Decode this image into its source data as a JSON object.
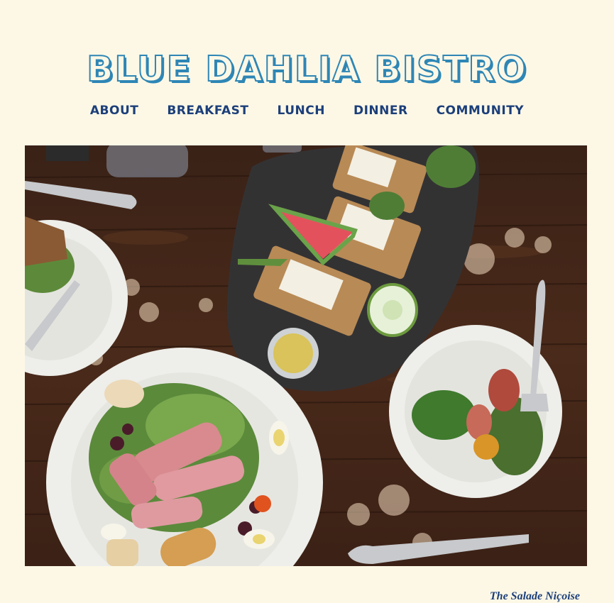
{
  "site": {
    "title": "BLUE DAHLIA BISTRO"
  },
  "nav": {
    "items": [
      {
        "label": "ABOUT"
      },
      {
        "label": "BREAKFAST"
      },
      {
        "label": "LUNCH"
      },
      {
        "label": "DINNER"
      },
      {
        "label": "COMMUNITY"
      }
    ]
  },
  "hero": {
    "caption": "The Salade Niçoise",
    "alt": "Overhead view of salade niçoise, open-faced sandwiches with watermelon, and side salads on a wooden table"
  },
  "colors": {
    "background": "#fdf8e6",
    "logo": "#2e86b5",
    "nav": "#1c3f7a"
  }
}
